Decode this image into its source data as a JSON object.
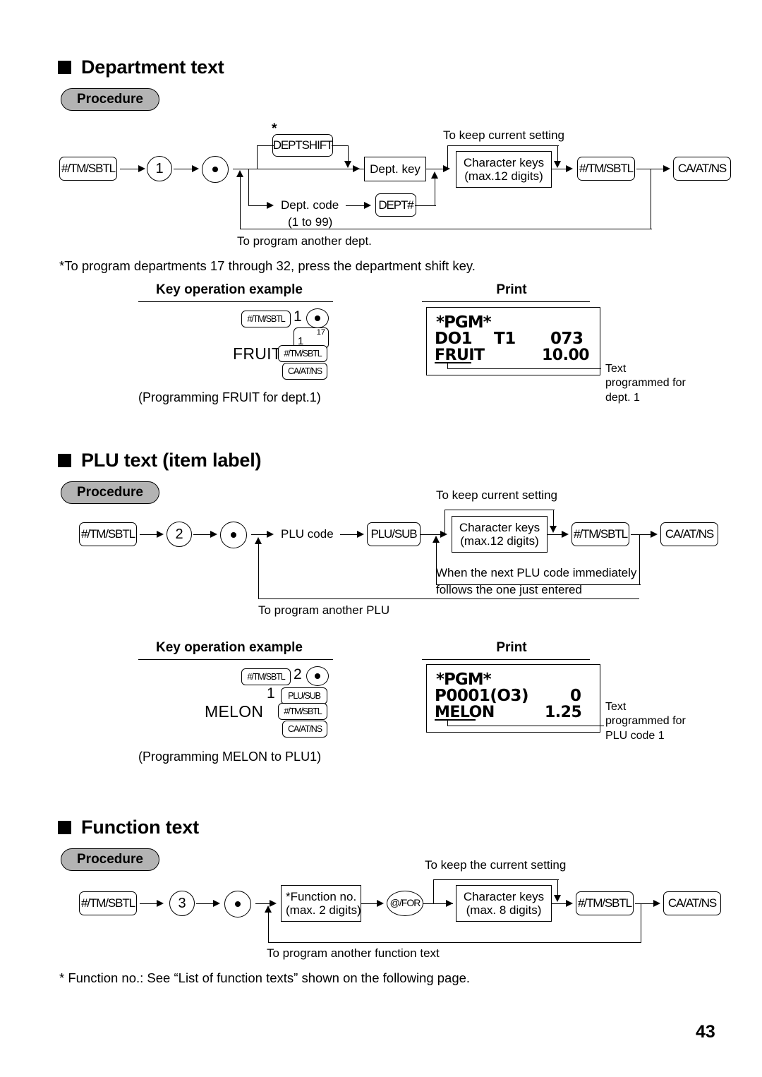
{
  "page": {
    "number": "43"
  },
  "sections": [
    {
      "id": "department-text",
      "title": "Department text",
      "procedure_label": "Procedure",
      "flow": {
        "start_key": "#/TM/SBTL",
        "mode_digit": "1",
        "deptshift_key": "DEPTSHIFT",
        "deptshift_asterisk": "*",
        "dept_key": "Dept. key",
        "dept_code": "Dept. code",
        "dept_code_range": "(1 to 99)",
        "dept_hash_key": "DEPT#",
        "keep_setting": "To keep current setting",
        "char_keys_line1": "Character keys",
        "char_keys_line2": "(max.12 digits)",
        "end_key": "#/TM/SBTL",
        "finish_key": "CA/AT/NS",
        "loop_label": "To program another dept."
      },
      "footnote": "*To program departments 17 through 32, press the department shift key.",
      "example": {
        "heading": "Key operation example",
        "keys_row1_chip": "#/TM/SBTL",
        "keys_row1_num": "1",
        "keys_row1_dot": "dot-key",
        "dual_key_main": "1",
        "dual_key_sup": "17",
        "keys_row3_word": "FRUIT",
        "keys_row3_chip": "#/TM/SBTL",
        "keys_row4_chip": "CA/AT/NS",
        "caption": "(Programming FRUIT for dept.1)"
      },
      "print": {
        "heading": "Print",
        "line1": "*PGM*",
        "line2_left": "DO1",
        "line2_mid": "T1",
        "line2_right": "073",
        "line3_left": "FRUIT",
        "line3_right": "10.00",
        "note": "Text\nprogrammed for\ndept. 1"
      }
    },
    {
      "id": "plu-text",
      "title": "PLU text (item label)",
      "procedure_label": "Procedure",
      "flow": {
        "start_key": "#/TM/SBTL",
        "mode_digit": "2",
        "plu_code": "PLU code",
        "plu_sub_key": "PLU/SUB",
        "keep_setting": "To keep current setting",
        "char_keys_line1": "Character keys",
        "char_keys_line2": "(max.12 digits)",
        "end_key": "#/TM/SBTL",
        "finish_key": "CA/AT/NS",
        "next_plu_line1": "When the next PLU code immediately",
        "next_plu_line2": "follows the one just entered",
        "loop_label": "To program another PLU"
      },
      "example": {
        "heading": "Key operation example",
        "keys_row1_chip": "#/TM/SBTL",
        "keys_row1_num": "2",
        "keys_row2_num": "1",
        "keys_row2_chip": "PLU/SUB",
        "keys_row3_word": "MELON",
        "keys_row3_chip": "#/TM/SBTL",
        "keys_row4_chip": "CA/AT/NS",
        "caption": "(Programming MELON to PLU1)"
      },
      "print": {
        "heading": "Print",
        "line1": "*PGM*",
        "line2_left": "P0001(O3)",
        "line2_right": "0",
        "line3_left": "MELON",
        "line3_right": "1.25",
        "note": "Text\nprogrammed for\nPLU code 1"
      }
    },
    {
      "id": "function-text",
      "title": "Function text",
      "procedure_label": "Procedure",
      "flow": {
        "start_key": "#/TM/SBTL",
        "mode_digit": "3",
        "func_no_line1": "*Function no.",
        "func_no_line2": "(max. 2 digits)",
        "at_for_key": "@/FOR",
        "keep_setting": "To keep the current setting",
        "char_keys_line1": "Character keys",
        "char_keys_line2": "(max. 8 digits)",
        "end_key": "#/TM/SBTL",
        "finish_key": "CA/AT/NS",
        "loop_label": "To program another function text"
      },
      "footnote": "* Function no.: See “List of function texts” shown on the following page."
    }
  ]
}
